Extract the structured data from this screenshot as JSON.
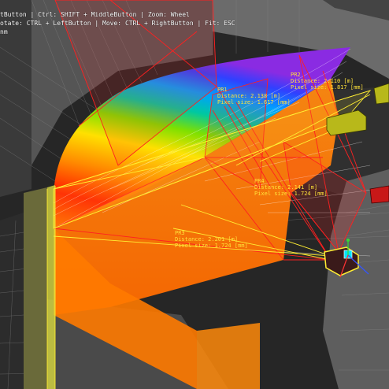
{
  "hud": {
    "line1": "tButton | Ctrl: SHIFT + MiddleButton | Zoom: Wheel",
    "line2": "otate: CTRL + LeftButton | Move: CTRL + RightButton | Fit: ESC",
    "line3": "nm"
  },
  "projectors": [
    {
      "id": "PR1",
      "distance": "Distance: 2.138 [m]",
      "pixel": "Pixel size: 1.617 [mm]"
    },
    {
      "id": "PR2",
      "distance": "Distance: 2.110 [m]",
      "pixel": "Pixel size: 1.817 [mm]"
    },
    {
      "id": "PR3",
      "distance": "Distance: 2.201 [m]",
      "pixel": "Pixel size: 1.724 [mm]"
    },
    {
      "id": "PR4",
      "distance": "Distance: 2.141 [m]",
      "pixel": "Pixel size: 1.724 [mm]"
    }
  ],
  "colors": {
    "background": "#262626",
    "wall": "#5a5a5a",
    "grid": "#8a8a8a",
    "frustum_red": "#ff2020",
    "frustum_yellow": "#ffee33",
    "projector_body": "#b8b81a",
    "projector_red": "#c81818",
    "label": "#ffe23a"
  }
}
